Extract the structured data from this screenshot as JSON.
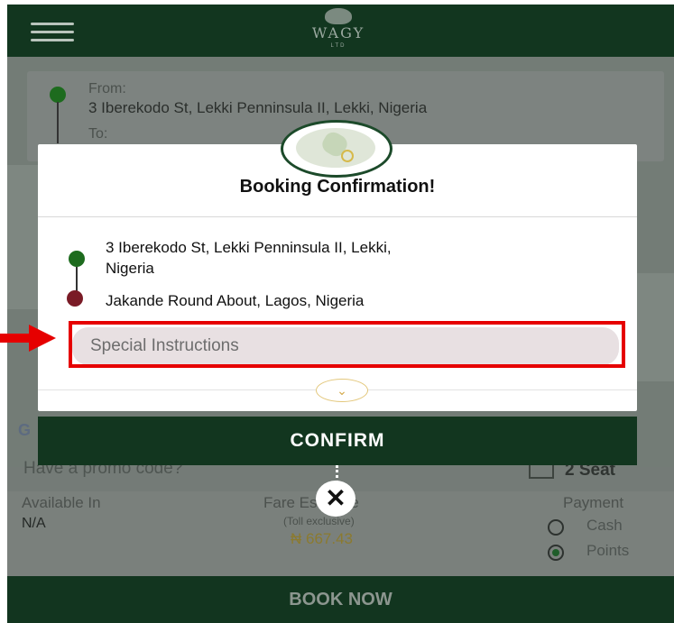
{
  "app": {
    "logo_text": "WAGY",
    "logo_sub": "LTD"
  },
  "background": {
    "from_label": "From:",
    "from_address": "3 Iberekodo St, Lekki Penninsula II, Lekki, Nigeria",
    "to_label": "To:",
    "map_attribution": "G",
    "promo_placeholder": "Have a promo code?",
    "seat_label": "2 Seat",
    "available_label": "Available In",
    "available_value": "N/A",
    "fare_label": "Fare Estimate",
    "fare_note": "(Toll exclusive)",
    "fare_value": "₦ 667.43",
    "payment_label": "Payment",
    "payment_options": [
      "Cash",
      "Points"
    ],
    "payment_selected": "Points",
    "book_now_label": "BOOK NOW"
  },
  "modal": {
    "title": "Booking Confirmation!",
    "pickup_line1": "3 Iberekodo St, Lekki Penninsula II, Lekki,",
    "pickup_line2": "Nigeria",
    "dropoff": "Jakande Round About, Lagos, Nigeria",
    "instructions_placeholder": "Special Instructions",
    "expand_icon": "chevron-down-icon",
    "confirm_label": "CONFIRM",
    "close_icon": "close-icon"
  },
  "annotation": {
    "color": "#e60000"
  },
  "colors": {
    "brand_dark_green": "#12361f",
    "pickup_green": "#1d6b1e",
    "dropoff_red": "#7a1b26",
    "accent_gold": "#d4a94a"
  }
}
